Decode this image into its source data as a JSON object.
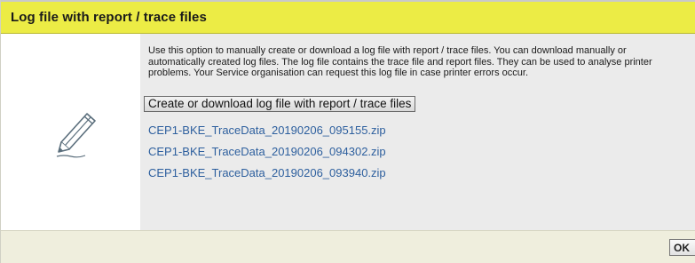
{
  "dialog": {
    "title": "Log file with report / trace files",
    "description": "Use this option to manually create or download a log file with report / trace files. You can download manually or automatically created log files. The log file contains the trace file and report files. They can be used to analyse printer problems. Your Service organisation can request this log file in case printer errors occur.",
    "create_button_label": "Create or download log file with report / trace files",
    "files": [
      "CEP1-BKE_TraceData_20190206_095155.zip",
      "CEP1-BKE_TraceData_20190206_094302.zip",
      "CEP1-BKE_TraceData_20190206_093940.zip"
    ],
    "ok_label": "OK",
    "icon": "pencil-icon"
  },
  "colors": {
    "title_bar": "#ecec45",
    "content_bg": "#ebebeb",
    "footer_bg": "#efeedd",
    "link": "#2d5f9e"
  }
}
